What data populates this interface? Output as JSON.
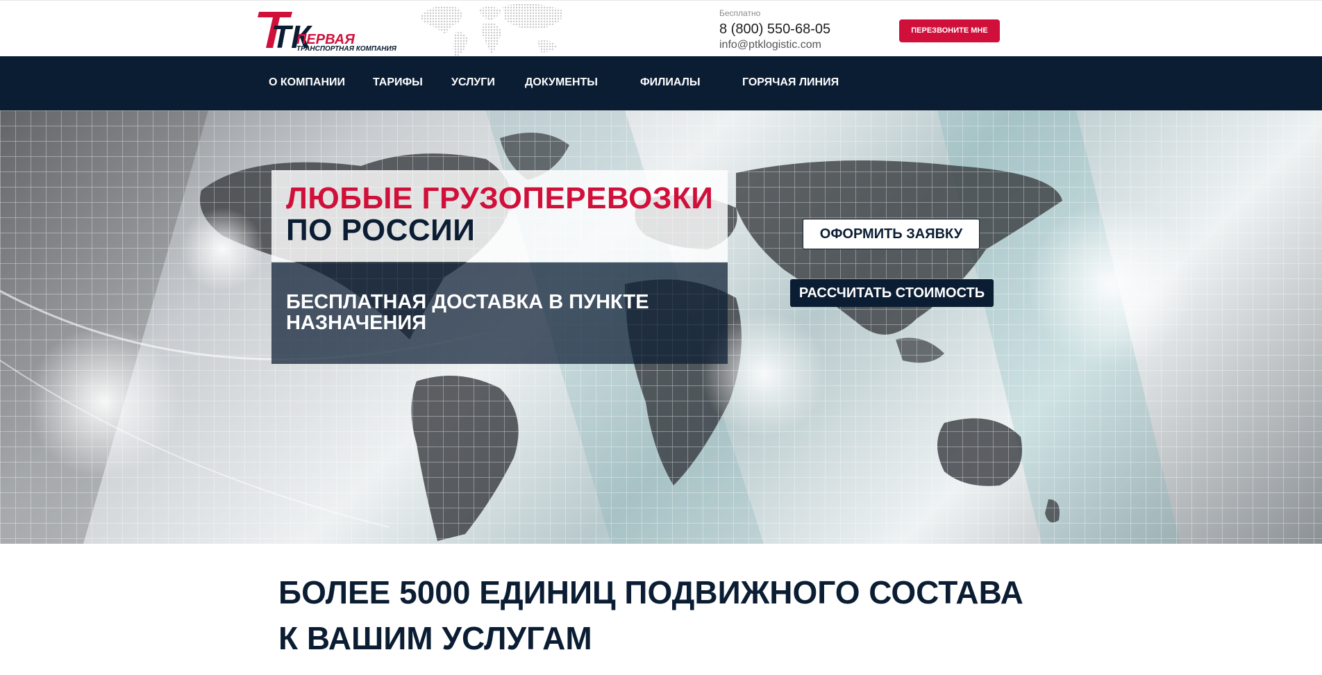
{
  "header": {
    "logo": {
      "letters": "ТК",
      "name": "ПЕРВАЯ",
      "tagline": "ТРАНСПОРТНАЯ КОМПАНИЯ"
    },
    "contact": {
      "free_label": "Бесплатно",
      "phone": "8 (800) 550-68-05",
      "email": "info@ptklogistic.com"
    },
    "callback_button": "ПЕРЕЗВОНИТЕ МНЕ"
  },
  "nav": {
    "items": [
      {
        "label": "О КОМПАНИИ"
      },
      {
        "label": "ТАРИФЫ"
      },
      {
        "label": "УСЛУГИ"
      },
      {
        "label": "ДОКУМЕНТЫ"
      },
      {
        "label": "ФИЛИАЛЫ"
      },
      {
        "label": "ГОРЯЧАЯ ЛИНИЯ"
      }
    ]
  },
  "hero": {
    "headline_line1": "ЛЮБЫЕ ГРУЗОПЕРЕВОЗКИ",
    "headline_line2": "ПО РОССИИ",
    "subline": "БЕСПЛАТНАЯ ДОСТАВКА В ПУНКТЕ НАЗНАЧЕНИЯ",
    "order_button": "ОФОРМИТЬ ЗАЯВКУ",
    "calc_button": "РАССЧИТАТЬ СТОИМОСТЬ"
  },
  "section": {
    "title_line1": "БОЛЕЕ 5000 ЕДИНИЦ ПОДВИЖНОГО СОСТАВА",
    "title_line2": "К ВАШИМ УСЛУГАМ"
  },
  "colors": {
    "brand_red": "#d0103a",
    "brand_navy": "#0b1d33"
  }
}
